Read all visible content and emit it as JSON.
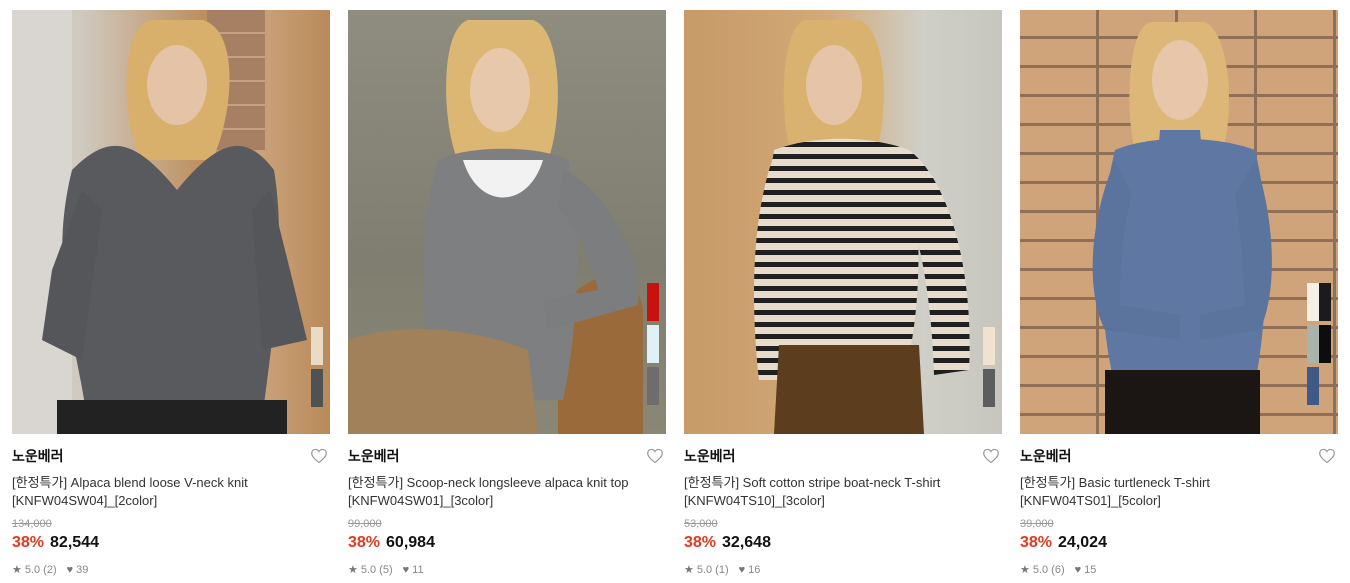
{
  "products": [
    {
      "brand": "노운베러",
      "name": "[한정특가] Alpaca blend loose V-neck knit [KNFW04SW04]_[2color]",
      "original_price": "134,000",
      "discount": "38%",
      "price": "82,544",
      "rating": "5.0",
      "review_count": "(2)",
      "likes": "39",
      "image_desc": "model in grey v-neck knit",
      "swatches": [
        "#e9dcc6",
        "#4f5255"
      ]
    },
    {
      "brand": "노운베러",
      "name": "[한정특가] Scoop-neck longsleeve alpaca knit top [KNFW04SW01]_[3color]",
      "original_price": "99,000",
      "discount": "38%",
      "price": "60,984",
      "rating": "5.0",
      "review_count": "(5)",
      "likes": "11",
      "image_desc": "model in grey scoop-neck knit",
      "swatches": [
        "#c7120f",
        "#dff1f6",
        "#6f6c6b"
      ]
    },
    {
      "brand": "노운베러",
      "name": "[한정특가] Soft cotton stripe boat-neck T-shirt [KNFW04TS10]_[3color]",
      "original_price": "53,000",
      "discount": "38%",
      "price": "32,648",
      "rating": "5.0",
      "review_count": "(1)",
      "likes": "16",
      "image_desc": "model in striped boat-neck tee",
      "swatches": [
        "#efe2cf",
        "#5c5d5f"
      ]
    },
    {
      "brand": "노운베러",
      "name": "[한정특가] Basic turtleneck T-shirt [KNFW04TS01]_[5color]",
      "original_price": "39,000",
      "discount": "38%",
      "price": "24,024",
      "rating": "5.0",
      "review_count": "(6)",
      "likes": "15",
      "image_desc": "model in blue turtleneck",
      "swatches": [
        [
          "#f4f0e8",
          "#1b1b1b"
        ],
        [
          "#a9b3ac",
          "#0d0d0d"
        ],
        [
          "#3f5a86"
        ]
      ]
    }
  ],
  "colors": {
    "discount": "#e03a1f",
    "muted": "#999999"
  },
  "icons": {
    "like": "heart-outline-icon",
    "rating": "star-icon",
    "likes_count": "heart-filled-icon"
  }
}
